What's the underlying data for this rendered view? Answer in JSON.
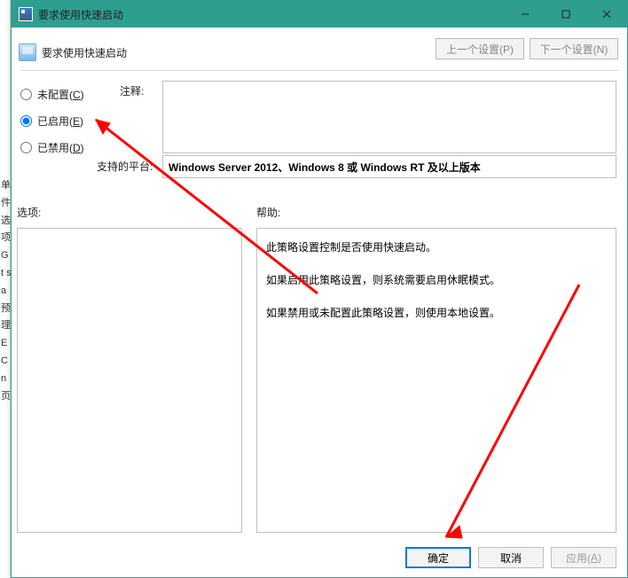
{
  "strip_chars": "单件\n\n\n选项:\n\n\n\n\nG\nt\n\ns\na\n\n预\n\n理\nE\nC\nn\n\n页",
  "title": "要求使用快速启动",
  "header_title": "要求使用快速启动",
  "nav": {
    "prev": "上一个设置(P)",
    "next": "下一个设置(N)"
  },
  "radios": {
    "not_configured": {
      "label": "未配置(",
      "key": "C",
      "tail": ")"
    },
    "enabled": {
      "label": "已启用(",
      "key": "E",
      "tail": ")"
    },
    "disabled": {
      "label": "已禁用(",
      "key": "D",
      "tail": ")"
    },
    "selected": "enabled"
  },
  "labels": {
    "comment": "注释:",
    "platform": "支持的平台:",
    "options": "选项:",
    "help": "帮助:"
  },
  "platform_text": "Windows Server 2012、Windows 8 或 Windows RT 及以上版本",
  "help_lines": [
    "此策略设置控制是否使用快速启动。",
    "如果启用此策略设置，则系统需要启用休眠模式。",
    "如果禁用或未配置此策略设置，则使用本地设置。"
  ],
  "buttons": {
    "ok": "确定",
    "cancel": "取消",
    "apply_label": "应用(",
    "apply_key": "A",
    "apply_tail": ")"
  }
}
